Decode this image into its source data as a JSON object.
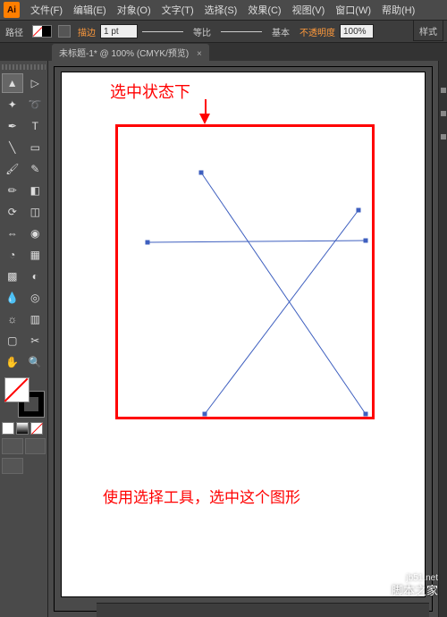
{
  "app": {
    "logo": "Ai"
  },
  "menu": {
    "file": "文件(F)",
    "edit": "编辑(E)",
    "object": "对象(O)",
    "type": "文字(T)",
    "select": "选择(S)",
    "effect": "效果(C)",
    "view": "视图(V)",
    "window": "窗口(W)",
    "help": "帮助(H)"
  },
  "control": {
    "path_label": "路径",
    "stroke_label": "描边",
    "stroke_weight": "1 pt",
    "profile_label": "等比",
    "brush_label": "基本",
    "opacity_label": "不透明度",
    "opacity_value": "100%",
    "style_btn": "样式"
  },
  "tab": {
    "title": "未标题-1* @ 100% (CMYK/预览)",
    "close": "×"
  },
  "annotations": {
    "top": "选中状态下",
    "bottom": "使用选择工具，选中这个图形"
  },
  "tool_glyphs": {
    "selection": "▲",
    "direct": "▷",
    "wand": "✦",
    "lasso": "➰",
    "pen": "✒",
    "type": "T",
    "line": "╲",
    "rect": "▭",
    "brush": "🖌",
    "blob": "✎",
    "pencil": "✏",
    "eraser": "◧",
    "rotate": "⟳",
    "scale": "◫",
    "width": "⇔",
    "warp": "◉",
    "shapebuilder": "◔",
    "perspective": "▦",
    "mesh": "▩",
    "gradient": "◐",
    "eyedropper": "💧",
    "blend": "◎",
    "symbol": "☼",
    "graph": "▥",
    "artboard": "▢",
    "slice": "✂",
    "hand": "✋",
    "zoom": "🔍"
  },
  "watermark": {
    "url": "jb51.net",
    "text": "脚本之家"
  }
}
